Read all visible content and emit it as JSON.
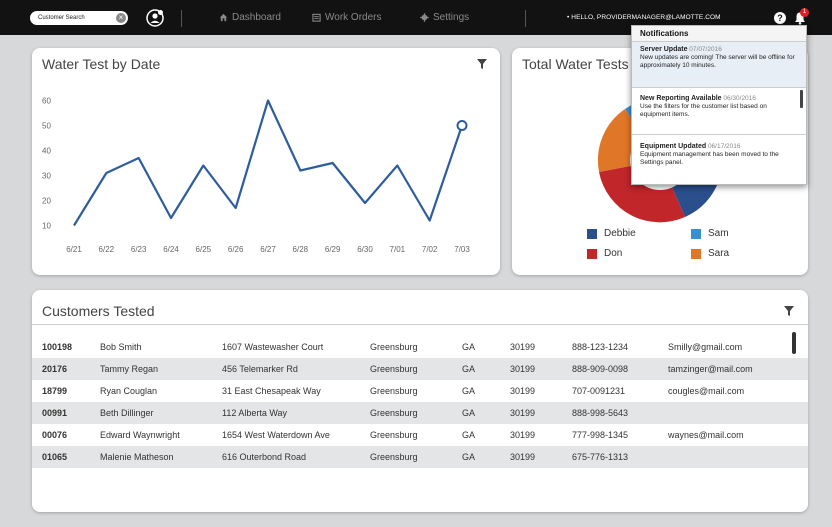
{
  "topbar": {
    "search_placeholder": "Customer Search",
    "nav": [
      {
        "label": "Dashboard",
        "icon": "home-icon"
      },
      {
        "label": "Work Orders",
        "icon": "clipboard-icon"
      },
      {
        "label": "Settings",
        "icon": "gear-icon"
      }
    ],
    "greeting": "• HELLO, PROVIDERMANAGER@LAMOTTE.COM",
    "notification_count": "1"
  },
  "water_test_panel": {
    "title": "Water Test by Date",
    "chart_data": {
      "type": "line",
      "categories": [
        "6/21",
        "6/22",
        "6/23",
        "6/24",
        "6/25",
        "6/26",
        "6/27",
        "6/28",
        "6/29",
        "6/30",
        "7/01",
        "7/02",
        "7/03"
      ],
      "values": [
        10,
        31,
        37,
        13,
        34,
        17,
        60,
        32,
        35,
        19,
        34,
        12,
        50
      ],
      "yticks": [
        10,
        20,
        30,
        40,
        50,
        60
      ],
      "ylim": [
        5,
        65
      ],
      "line_color": "#2e5d9e"
    }
  },
  "total_tests_panel": {
    "title": "Total Water Tests",
    "chart_data": {
      "type": "pie",
      "legend": [
        {
          "name": "Debbie",
          "color": "#2a4f8c"
        },
        {
          "name": "Sam",
          "color": "#3a8fd1"
        },
        {
          "name": "Don",
          "color": "#c1262b"
        },
        {
          "name": "Sara",
          "color": "#e07628"
        }
      ]
    }
  },
  "customers_panel": {
    "title": "Customers Tested",
    "rows": [
      {
        "id": "100198",
        "name": "Bob Smith",
        "address": "1607 Wastewasher Court",
        "city": "Greensburg",
        "state": "GA",
        "zip": "30199",
        "phone": "888-123-1234",
        "email": "Smilly@gmail.com"
      },
      {
        "id": "20176",
        "name": "Tammy Regan",
        "address": "456 Telemarker Rd",
        "city": "Greensburg",
        "state": "GA",
        "zip": "30199",
        "phone": "888-909-0098",
        "email": "tamzinger@mail.com"
      },
      {
        "id": "18799",
        "name": "Ryan Couglan",
        "address": "31 East Chesapeak Way",
        "city": "Greensburg",
        "state": "GA",
        "zip": "30199",
        "phone": "707-0091231",
        "email": "cougles@mail.com"
      },
      {
        "id": "00991",
        "name": "Beth Dillinger",
        "address": "112 Alberta Way",
        "city": "Greensburg",
        "state": "GA",
        "zip": "30199",
        "phone": "888-998-5643",
        "email": ""
      },
      {
        "id": "00076",
        "name": "Edward Waynwright",
        "address": "1654 West Waterdown Ave",
        "city": "Greensburg",
        "state": "GA",
        "zip": "30199",
        "phone": "777-998-1345",
        "email": "waynes@mail.com"
      },
      {
        "id": "01065",
        "name": "Malenie Matheson",
        "address": "616 Outerbond Road",
        "city": "Greensburg",
        "state": "GA",
        "zip": "30199",
        "phone": "675-776-1313",
        "email": ""
      }
    ]
  },
  "notifications": {
    "header": "Notifications",
    "items": [
      {
        "title": "Server Update",
        "date": "07/07/2016",
        "body": "New updates are coming! The server will be offline for approximately 10 minutes."
      },
      {
        "title": "New Reporting Available",
        "date": "06/30/2016",
        "body": "Use the filters for the customer list based on equipment items."
      },
      {
        "title": "Equipment Updated",
        "date": "06/17/2016",
        "body": "Equipment management has been moved to the Settings panel."
      }
    ]
  }
}
